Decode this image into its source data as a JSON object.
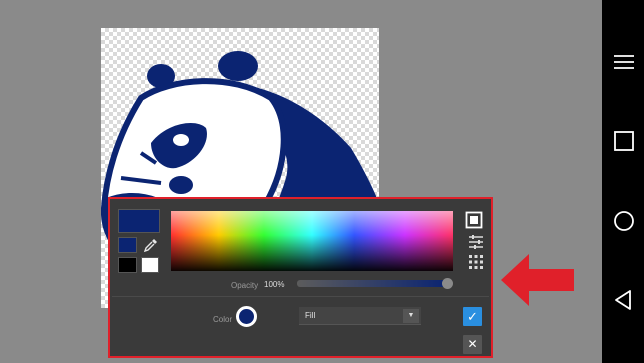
{
  "colors": {
    "accent": "#0b2472",
    "highlight_box": "#e0202a",
    "confirm_button": "#2a8fe0",
    "panel_bg": "#3a3a3a",
    "canvas_bg": "#8a8a8a",
    "nav_bar_bg": "#000000"
  },
  "color_panel": {
    "swatches": {
      "current": "#0b2472",
      "previous": "#0b2472",
      "black": "#000000",
      "white": "#ffffff"
    },
    "opacity": {
      "label": "Opacity",
      "value_text": "100%",
      "value": 1.0
    },
    "color": {
      "label": "Color",
      "dot_color": "#0b2472"
    },
    "fill_select": {
      "selected": "Fill"
    },
    "icons": [
      "eyedropper-icon",
      "square-mode-icon",
      "sliders-icon",
      "grid-icon",
      "chevron-down-icon",
      "check-icon",
      "close-icon"
    ],
    "confirm_glyph": "✓",
    "close_glyph": "✕"
  },
  "nav_bar": {
    "icons": [
      "menu-icon",
      "recents-icon",
      "home-icon",
      "back-icon"
    ]
  }
}
